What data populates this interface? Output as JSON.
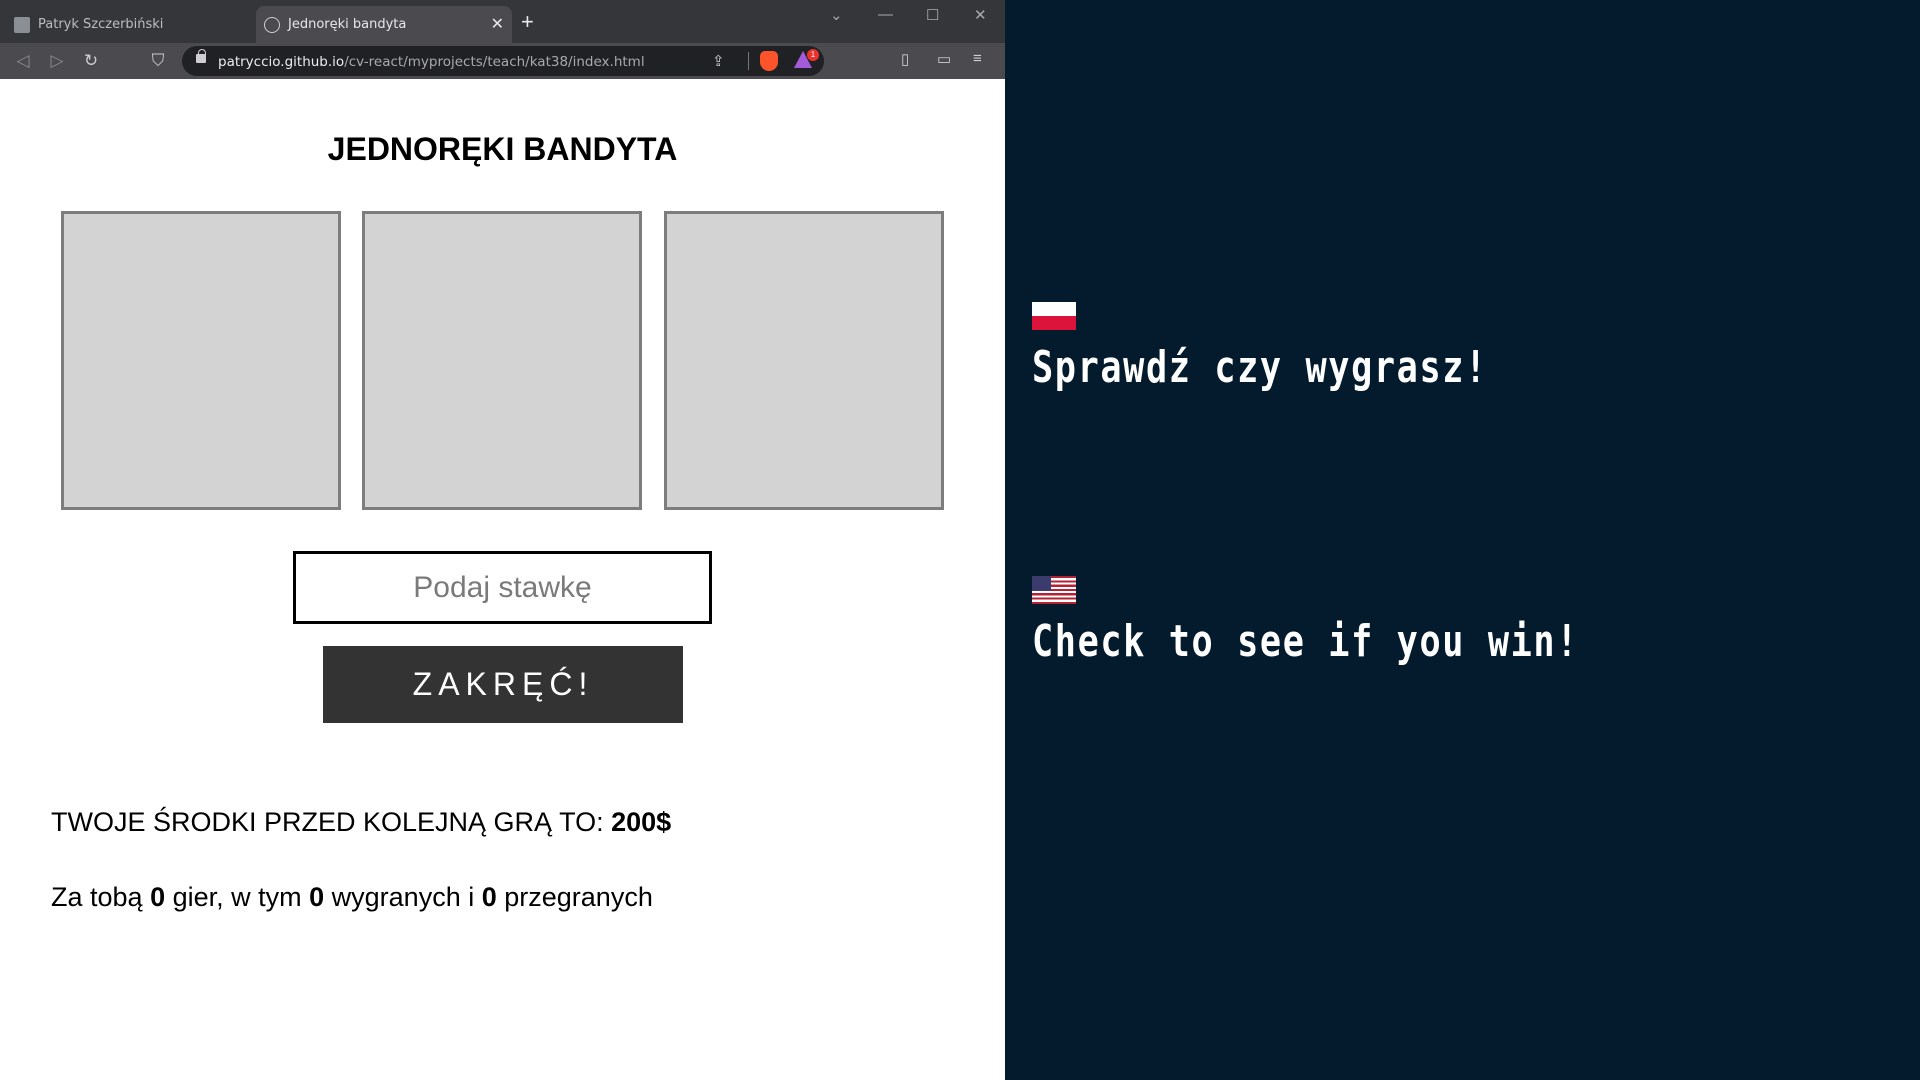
{
  "browser": {
    "tabs": [
      {
        "title": "Patryk Szczerbiński",
        "active": false
      },
      {
        "title": "Jednoręki bandyta",
        "active": true
      }
    ],
    "url_host": "patryccio.github.io",
    "url_path": "/cv-react/myprojects/teach/kat38/index.html",
    "rewards_badge": "1"
  },
  "game": {
    "title": "JEDNORĘKI BANDYTA",
    "slots": [
      "",
      "",
      ""
    ],
    "bet_placeholder": "Podaj stawkę",
    "bet_value": "",
    "spin_label": "ZAKRĘĆ!",
    "funds_label": "TWOJE ŚRODKI PRZED KOLEJNĄ GRĄ TO: ",
    "funds_value": "200$",
    "stats": {
      "prefix": "Za tobą ",
      "games": "0",
      "games_suffix": " gier, w tym ",
      "wins": "0",
      "wins_suffix": " wygranych i ",
      "losses": "0",
      "losses_suffix": " przegranych"
    }
  },
  "captions": {
    "pl": "Sprawdź czy wygrasz!",
    "en": "Check to see if you win!"
  },
  "colors": {
    "right_panel": "#041b2d",
    "slot_fill": "#d3d3d3",
    "button": "#333333"
  }
}
